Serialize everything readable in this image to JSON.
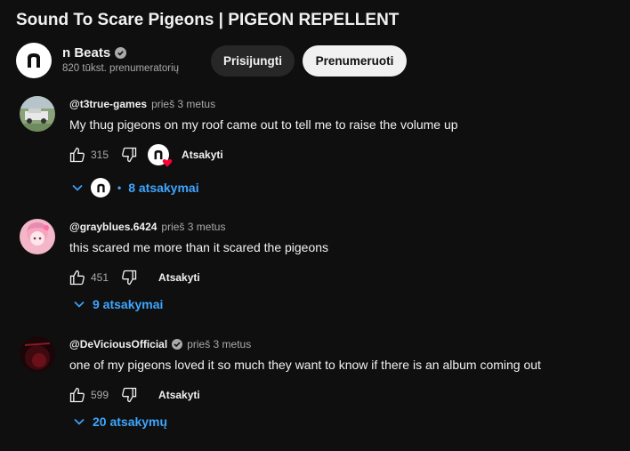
{
  "video": {
    "title": "Sound To Scare Pigeons | PIGEON REPELLENT"
  },
  "channel": {
    "name": "n Beats",
    "subscribers": "820 tūkst. prenumeratorių",
    "join_label": "Prisijungti",
    "subscribe_label": "Prenumeruoti"
  },
  "comments": [
    {
      "author": "@t3true-games",
      "time": "prieš 3 metus",
      "text": "My thug pigeons on my roof came out to tell me to raise the volume up",
      "likes": "315",
      "reply_label": "Atsakyti",
      "replies_label": "8 atsakymai",
      "creator_hearted": true,
      "creator_replied": true
    },
    {
      "author": "@grayblues.6424",
      "time": "prieš 3 metus",
      "text": "this scared me more than it scared the pigeons",
      "likes": "451",
      "reply_label": "Atsakyti",
      "replies_label": "9 atsakymai"
    },
    {
      "author": "@DeViciousOfficial",
      "time": "prieš 3 metus",
      "text": "one of my pigeons loved it so much they want to know if there is an album coming out",
      "likes": "599",
      "reply_label": "Atsakyti",
      "replies_label": "20 atsakymų",
      "verified": true
    }
  ],
  "colors": {
    "background": "#0f0f0f",
    "link": "#3ea6ff",
    "heart": "#ff0033"
  }
}
